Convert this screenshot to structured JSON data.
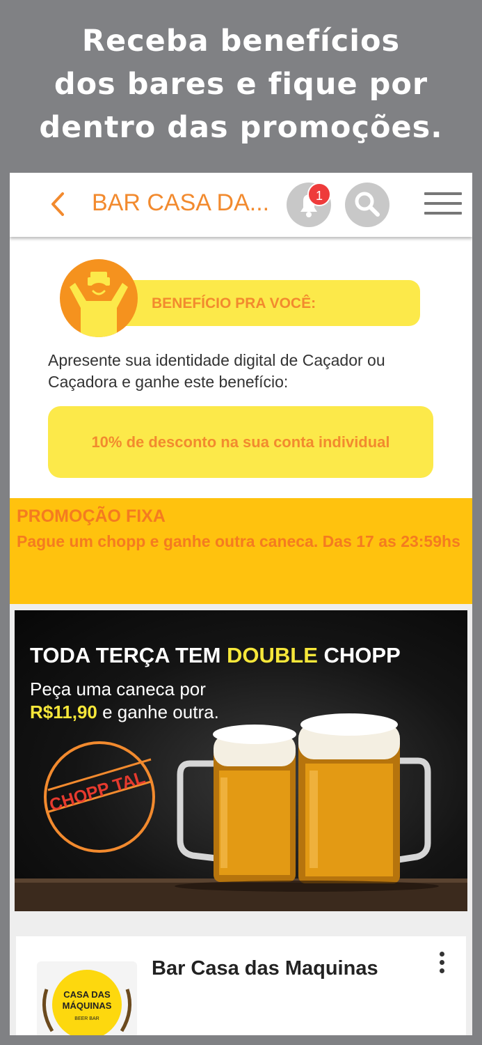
{
  "headline": {
    "line1": "Receba benefícios",
    "line2": "dos bares e fique por",
    "line3": "dentro das promoções."
  },
  "topbar": {
    "title": "BAR CASA DA...",
    "notification_count": "1",
    "icons": [
      "back-icon",
      "bell-icon",
      "search-icon",
      "menu-icon"
    ]
  },
  "benefit": {
    "label": "BENEFÍCIO PRA VOCÊ:",
    "description": "Apresente sua identidade digital de Caçador ou Caçadora e ganhe este benefício:",
    "discount": "10% de desconto na sua conta individual"
  },
  "promo": {
    "title": "PROMOÇÃO FIXA",
    "text": "Pague um chopp e ganhe outra caneca. Das 17 as 23:59hs"
  },
  "banner": {
    "headline_pre": "TODA TERÇA TEM ",
    "headline_highlight": "DOUBLE",
    "headline_post": " CHOPP",
    "line1": "Peça uma caneca por",
    "price": "R$11,90",
    "line2_rest": " e ganhe outra.",
    "stamp": "CHOPP TAL"
  },
  "bar_card": {
    "name": "Bar Casa das Maquinas",
    "logo_line1": "CASA DAS",
    "logo_line2": "MÁQUINAS",
    "logo_line3": "BEER BAR"
  },
  "colors": {
    "accent_orange": "#F28A2E",
    "yellow_pill": "#FCE94A",
    "promo_bg": "#FFC20E",
    "badge_red": "#EE3B3B",
    "frame_gray": "#808184"
  }
}
